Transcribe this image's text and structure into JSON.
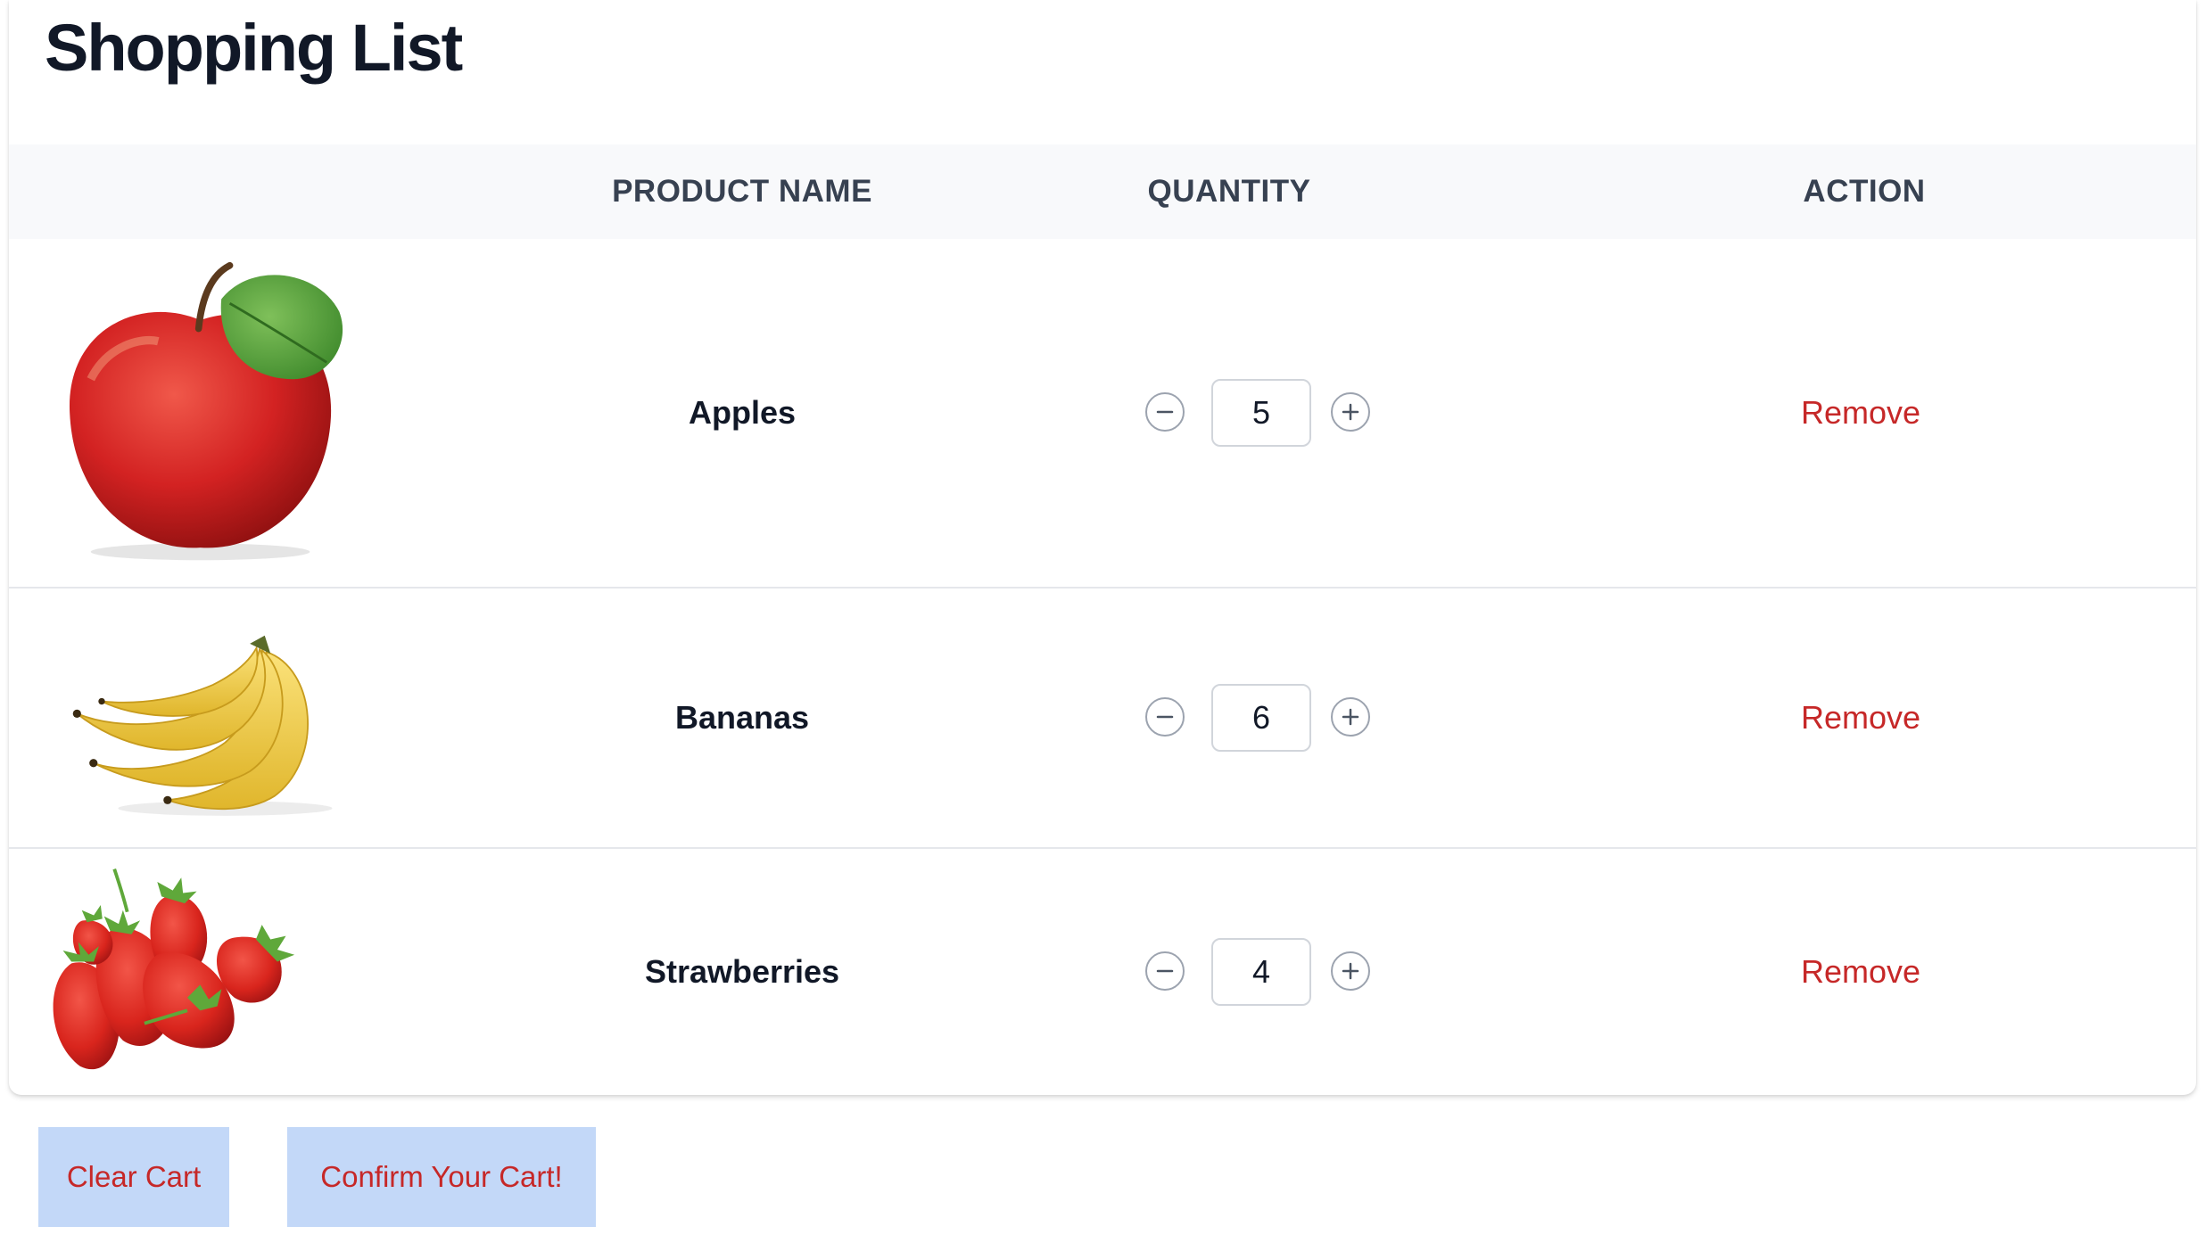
{
  "page": {
    "title": "Shopping List"
  },
  "table": {
    "headers": {
      "product_name": "PRODUCT NAME",
      "quantity": "QUANTITY",
      "action": "ACTION"
    },
    "rows": [
      {
        "name": "Apples",
        "quantity": "5",
        "action_label": "Remove",
        "image": "apple"
      },
      {
        "name": "Bananas",
        "quantity": "6",
        "action_label": "Remove",
        "image": "bananas"
      },
      {
        "name": "Strawberries",
        "quantity": "4",
        "action_label": "Remove",
        "image": "strawberries"
      }
    ]
  },
  "footer": {
    "clear_label": "Clear Cart",
    "confirm_label": "Confirm Your Cart!"
  },
  "colors": {
    "remove_text": "#c62828",
    "button_bg": "#c3d8f8",
    "header_bg": "#f8f9fb"
  },
  "icons": {
    "decrement": "minus-circle-icon",
    "increment": "plus-circle-icon"
  }
}
